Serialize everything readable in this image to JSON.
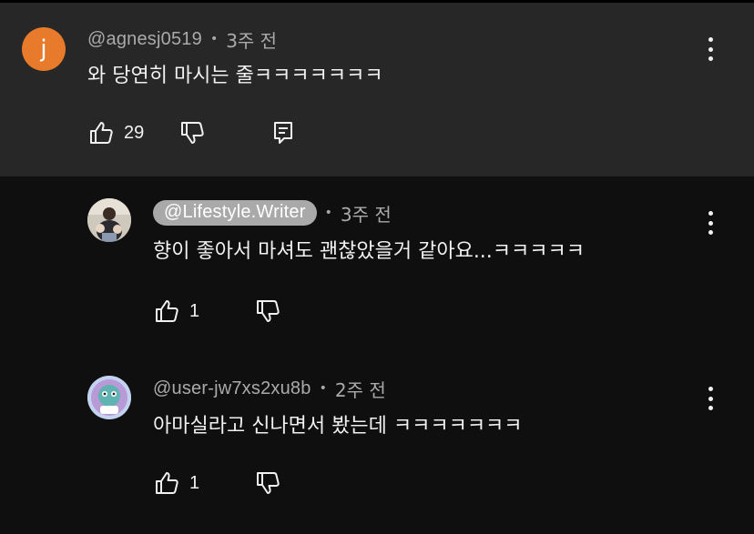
{
  "comments": [
    {
      "handle": "@agnesj0519",
      "time": "3주 전",
      "text": "와 당연히 마시는 줄ㅋㅋㅋㅋㅋㅋㅋ",
      "likes": "29",
      "avatar_letter": "j",
      "avatar_color": "#e87b2b",
      "icons": [
        "thumbs-up-icon",
        "thumbs-down-icon",
        "reply-icon",
        "more-vert-icon"
      ]
    },
    {
      "handle": "@Lifestyle.Writer",
      "time": "3주 전",
      "text": "향이 좋아서 마셔도 괜찮았을거 같아요...ㅋㅋㅋㅋㅋ",
      "likes": "1",
      "icons": [
        "thumbs-up-icon",
        "thumbs-down-icon",
        "more-vert-icon"
      ]
    },
    {
      "handle": "@user-jw7xs2xu8b",
      "time": "2주 전",
      "text": "아마실라고 신나면서 봤는데 ㅋㅋㅋㅋㅋㅋㅋ",
      "likes": "1",
      "icons": [
        "thumbs-up-icon",
        "thumbs-down-icon",
        "more-vert-icon"
      ]
    }
  ],
  "colors": {
    "background": "#0f0f0f",
    "highlight_background": "#272727",
    "secondary_text": "#aaaaaa",
    "primary_text": "#f1f1f1",
    "handle_chip": "#a9a9a9"
  }
}
